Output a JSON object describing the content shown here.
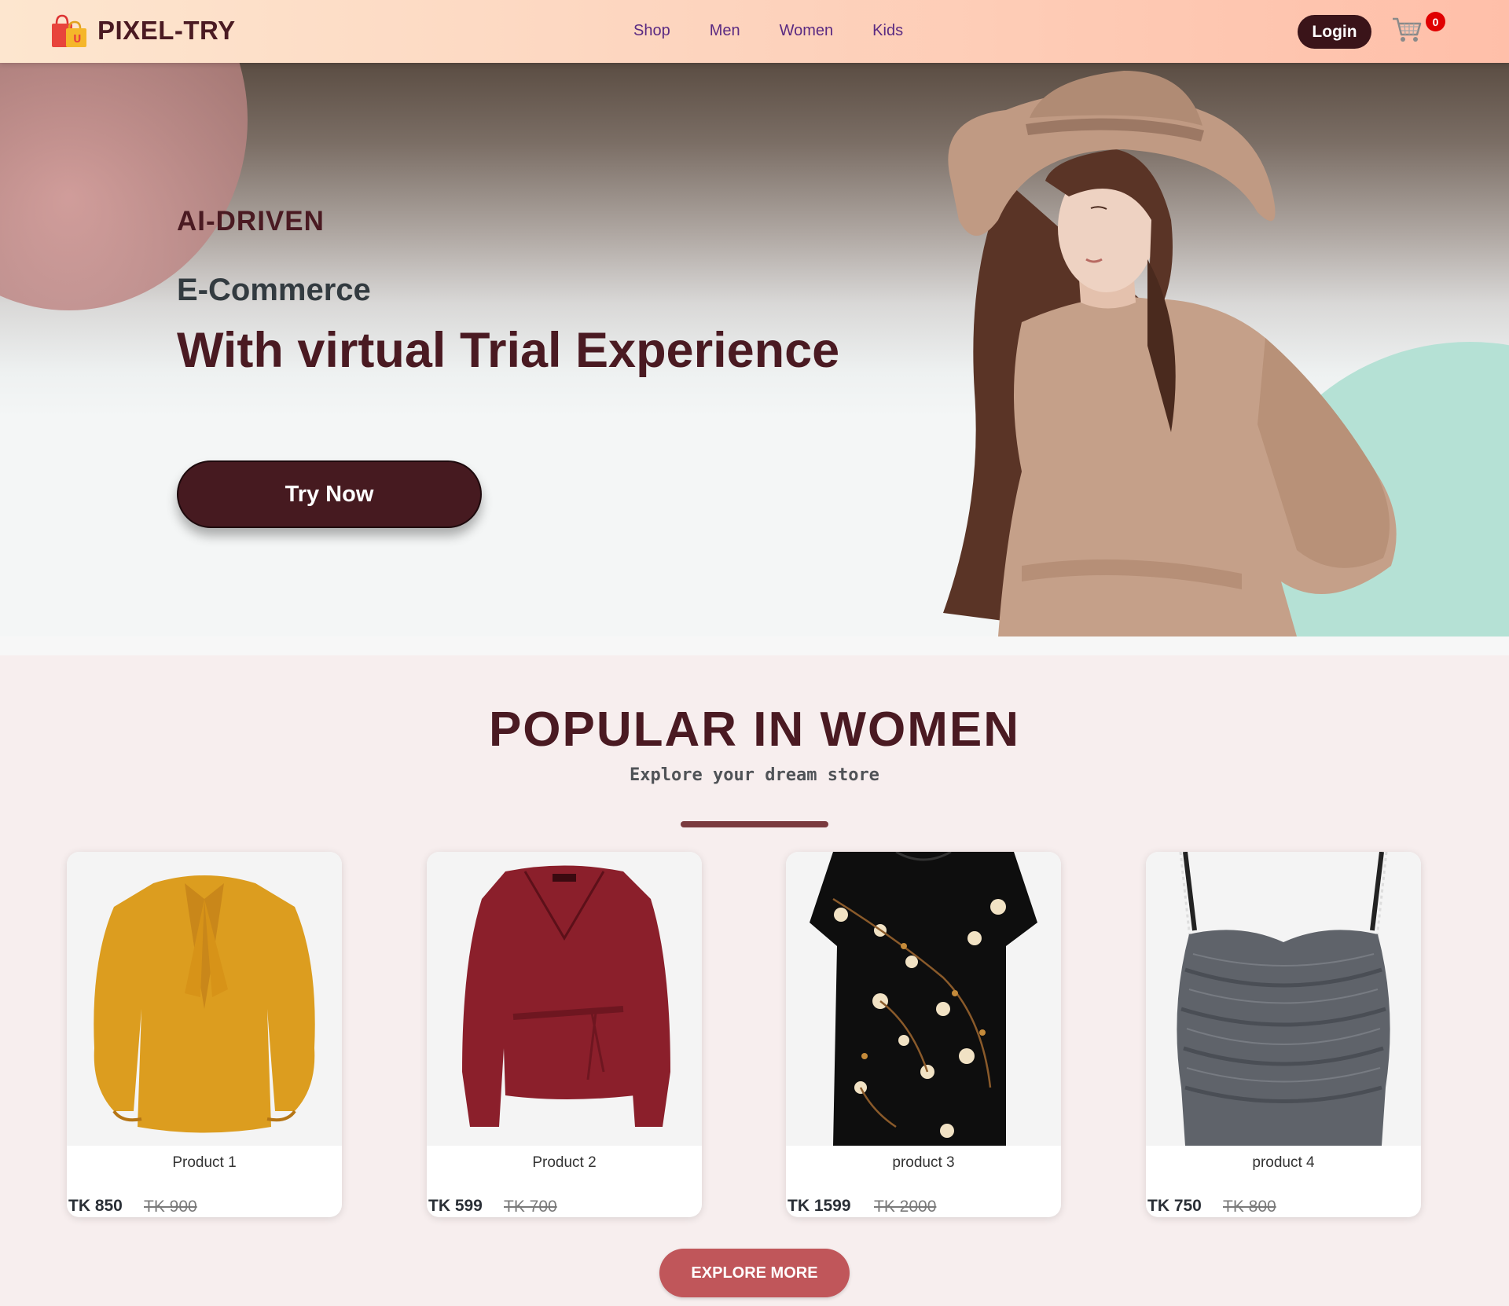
{
  "brand": {
    "name": "PIXEL-TRY",
    "logo_icon": "shopping-bags-icon"
  },
  "nav": {
    "links": [
      {
        "label": "Shop"
      },
      {
        "label": "Men"
      },
      {
        "label": "Women"
      },
      {
        "label": "Kids"
      }
    ],
    "login_label": "Login",
    "cart_icon": "cart-icon",
    "cart_count": "0"
  },
  "hero": {
    "kicker": "AI-DRIVEN",
    "subtitle": "E-Commerce",
    "title": "With virtual Trial Experience",
    "cta_label": "Try Now"
  },
  "popular": {
    "title": "POPULAR IN WOMEN",
    "subtitle": "Explore your dream store",
    "products": [
      {
        "name": "Product 1",
        "price": "TK 850",
        "old_price": "TK 900"
      },
      {
        "name": "Product 2",
        "price": "TK 599",
        "old_price": "TK 700"
      },
      {
        "name": "product 3",
        "price": "TK 1599",
        "old_price": "TK 2000"
      },
      {
        "name": "product 4",
        "price": "TK 750",
        "old_price": "TK 800"
      }
    ],
    "explore_label": "EXPLORE MORE"
  },
  "colors": {
    "brand_dark": "#4a1a22",
    "nav_link": "#5a2a82",
    "cta": "#461a20",
    "explore": "#c0565a",
    "badge": "#e00000"
  }
}
